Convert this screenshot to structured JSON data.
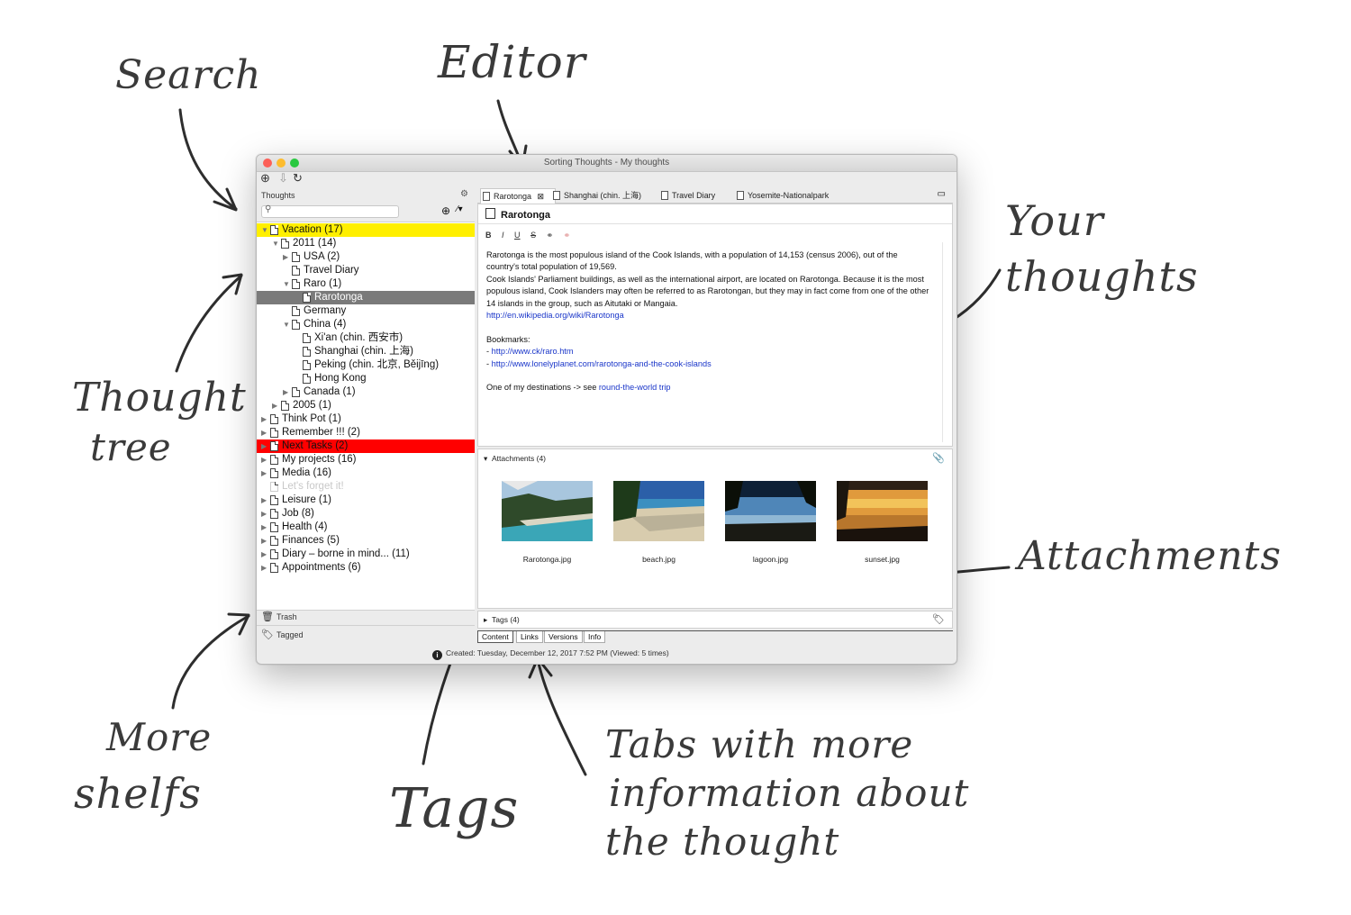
{
  "annotations": {
    "search": "Search",
    "editor": "Editor",
    "your_thoughts_1": "Your",
    "your_thoughts_2": "thoughts",
    "thought_tree_1": "Thought",
    "thought_tree_2": "tree",
    "attachments": "Attachments",
    "more_shelfs_1": "More",
    "more_shelfs_2": "shelfs",
    "tags": "Tags",
    "tabs_info_1": "Tabs with more",
    "tabs_info_2": "information about",
    "tabs_info_3": "the thought"
  },
  "window": {
    "title": "Sorting Thoughts - My thoughts",
    "traffic_lights": [
      "#fc5f57",
      "#fdbc2e",
      "#28c840"
    ]
  },
  "toolbar": {
    "icons": [
      "new-thought-icon",
      "import-icon",
      "sync-icon"
    ]
  },
  "sidebar": {
    "header": "Thoughts",
    "search_placeholder": "",
    "tree": [
      {
        "label": "Vacation (17)",
        "level": 0,
        "expanded": true,
        "highlight": "#ffef00"
      },
      {
        "label": "2011 (14)",
        "level": 1,
        "expanded": true
      },
      {
        "label": "USA (2)",
        "level": 2,
        "expanded": false
      },
      {
        "label": "Travel Diary",
        "level": 2,
        "leaf": true
      },
      {
        "label": "Raro (1)",
        "level": 2,
        "expanded": true
      },
      {
        "label": "Rarotonga",
        "level": 3,
        "leaf": true,
        "selected": true,
        "picture": true
      },
      {
        "label": "Germany",
        "level": 2,
        "leaf": true
      },
      {
        "label": "China (4)",
        "level": 2,
        "expanded": true
      },
      {
        "label": "Xi'an (chin. 西安市)",
        "level": 3,
        "leaf": true
      },
      {
        "label": "Shanghai (chin. 上海)",
        "level": 3,
        "leaf": true
      },
      {
        "label": "Peking (chin. 北京, Běijīng)",
        "level": 3,
        "leaf": true
      },
      {
        "label": "Hong Kong",
        "level": 3,
        "leaf": true
      },
      {
        "label": "Canada (1)",
        "level": 2,
        "expanded": false
      },
      {
        "label": "2005 (1)",
        "level": 1,
        "expanded": false
      },
      {
        "label": "Think Pot (1)",
        "level": 0,
        "expanded": false
      },
      {
        "label": "Remember !!! (2)",
        "level": 0,
        "expanded": false
      },
      {
        "label": "Next Tasks (2)",
        "level": 0,
        "expanded": false,
        "highlight": "#ff0000"
      },
      {
        "label": "My projects (16)",
        "level": 0,
        "expanded": false
      },
      {
        "label": "Media (16)",
        "level": 0,
        "expanded": false
      },
      {
        "label": "Let's forget it!",
        "level": 0,
        "leaf": true,
        "faded": true
      },
      {
        "label": "Leisure (1)",
        "level": 0,
        "expanded": false
      },
      {
        "label": "Job (8)",
        "level": 0,
        "expanded": false
      },
      {
        "label": "Health (4)",
        "level": 0,
        "expanded": false
      },
      {
        "label": "Finances (5)",
        "level": 0,
        "expanded": false
      },
      {
        "label": "Diary – borne in mind... (11)",
        "level": 0,
        "expanded": false
      },
      {
        "label": "Appointments (6)",
        "level": 0,
        "expanded": false
      }
    ],
    "shelves": [
      {
        "label": "Trash",
        "icon": "trash-icon"
      },
      {
        "label": "Tagged",
        "icon": "tag-icon"
      }
    ]
  },
  "editor": {
    "tabs": [
      "Rarotonga",
      "Shanghai (chin. 上海)",
      "Travel Diary",
      "Yosemite-Nationalpark"
    ],
    "title": "Rarotonga",
    "format_buttons": [
      "B",
      "I",
      "U",
      "S"
    ],
    "paragraph1": "Rarotonga is the most populous island of the Cook Islands, with a population of 14,153 (census 2006), out of the country's total population of 19,569.",
    "paragraph2": "Cook Islands' Parliament buildings, as well as the international airport, are located on Rarotonga. Because it is the most populous island, Cook Islanders may often be referred to as Rarotongan, but they may in fact come from one of the other 14 islands in the group, such as Aitutaki or Mangaia.",
    "wiki_link": "http://en.wikipedia.org/wiki/Rarotonga",
    "bookmarks_label": "Bookmarks:",
    "bookmark1": "http://www.ck/raro.htm",
    "bookmark2": "http://www.lonelyplanet.com/rarotonga-and-the-cook-islands",
    "dest_text": "One of my destinations -> see ",
    "dest_link": "round-the-world trip"
  },
  "attachments": {
    "header": "Attachments (4)",
    "items": [
      {
        "name": "Rarotonga.jpg"
      },
      {
        "name": "beach.jpg"
      },
      {
        "name": "lagoon.jpg"
      },
      {
        "name": "sunset.jpg"
      }
    ]
  },
  "tags": {
    "header": "Tags (4)"
  },
  "bottom_tabs": [
    "Content",
    "Links",
    "Versions",
    "Info"
  ],
  "status": {
    "text": "Created: Tuesday, December 12, 2017 7:52 PM  (Viewed: 5 times)"
  },
  "colors": {
    "link": "#1a36c9",
    "selection": "#7a7a7a"
  }
}
